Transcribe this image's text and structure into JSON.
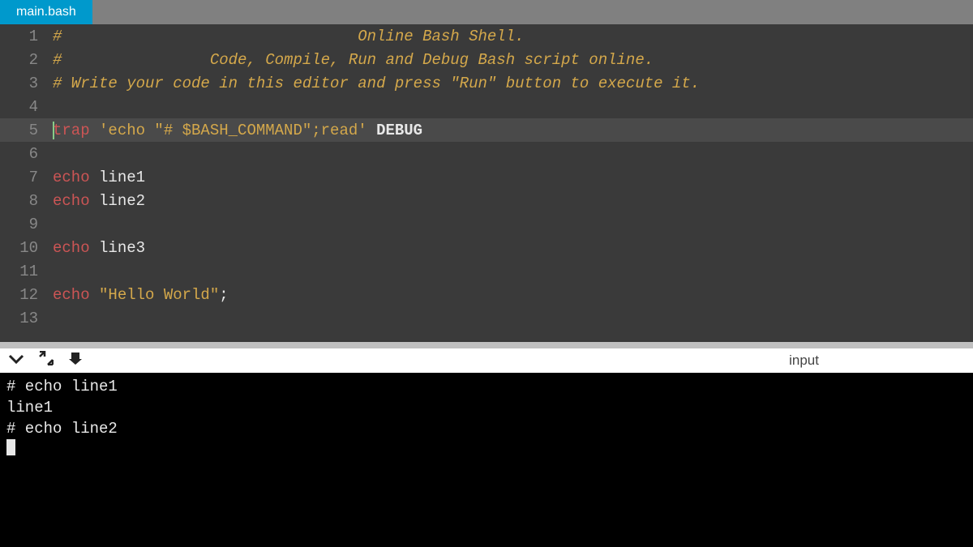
{
  "tab": {
    "name": "main.bash"
  },
  "editor": {
    "activeLine": 5,
    "lines": [
      {
        "n": 1,
        "segments": [
          {
            "cls": "comment",
            "t": "#                                Online Bash Shell."
          }
        ]
      },
      {
        "n": 2,
        "segments": [
          {
            "cls": "comment",
            "t": "#                Code, Compile, Run and Debug Bash script online."
          }
        ]
      },
      {
        "n": 3,
        "segments": [
          {
            "cls": "comment",
            "t": "# Write your code in this editor and press \"Run\" button to execute it."
          }
        ]
      },
      {
        "n": 4,
        "segments": []
      },
      {
        "n": 5,
        "cursor": true,
        "segments": [
          {
            "cls": "keyword",
            "t": "trap"
          },
          {
            "cls": "text-white",
            "t": " "
          },
          {
            "cls": "string",
            "t": "'echo \"# $BASH_COMMAND\";read'"
          },
          {
            "cls": "text-white",
            "t": " "
          },
          {
            "cls": "text-white text-bold",
            "t": "DEBUG"
          }
        ]
      },
      {
        "n": 6,
        "segments": []
      },
      {
        "n": 7,
        "segments": [
          {
            "cls": "keyword",
            "t": "echo"
          },
          {
            "cls": "text-white",
            "t": " line1"
          }
        ]
      },
      {
        "n": 8,
        "segments": [
          {
            "cls": "keyword",
            "t": "echo"
          },
          {
            "cls": "text-white",
            "t": " line2"
          }
        ]
      },
      {
        "n": 9,
        "segments": []
      },
      {
        "n": 10,
        "segments": [
          {
            "cls": "keyword",
            "t": "echo"
          },
          {
            "cls": "text-white",
            "t": " line3"
          }
        ]
      },
      {
        "n": 11,
        "segments": []
      },
      {
        "n": 12,
        "segments": [
          {
            "cls": "keyword",
            "t": "echo"
          },
          {
            "cls": "text-white",
            "t": " "
          },
          {
            "cls": "string",
            "t": "\"Hello World\""
          },
          {
            "cls": "text-white",
            "t": ";"
          }
        ]
      },
      {
        "n": 13,
        "segments": []
      }
    ]
  },
  "toolbar": {
    "input_label": "input"
  },
  "terminal": {
    "lines": [
      "# echo line1",
      "",
      "line1",
      "# echo line2"
    ]
  }
}
